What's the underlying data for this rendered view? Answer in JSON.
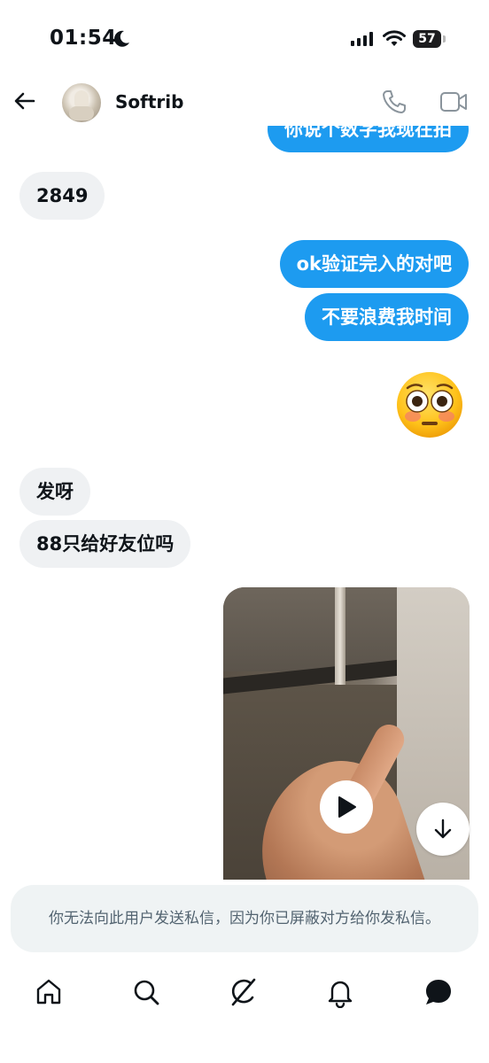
{
  "status_bar": {
    "time": "01:54",
    "battery": "57",
    "icons": [
      "moon-icon",
      "signal-icon",
      "wifi-icon",
      "battery-icon"
    ]
  },
  "header": {
    "username": "Softrib",
    "icons": [
      "back-arrow-icon",
      "phone-icon",
      "video-call-icon"
    ]
  },
  "messages": [
    {
      "side": "out",
      "text": "你说个数字我现在拍"
    },
    {
      "side": "in",
      "text": "2849"
    },
    {
      "side": "out",
      "text": "ok验证完入的对吧"
    },
    {
      "side": "out",
      "text": "不要浪费我时间"
    },
    {
      "side": "out",
      "emoji": "flushed-face"
    },
    {
      "side": "in",
      "text": "发呀"
    },
    {
      "side": "in",
      "text": "88只给好友位吗"
    },
    {
      "side": "out",
      "media": "video"
    }
  ],
  "notice": "你无法向此用户发送私信，因为你已屏蔽对方给你发私信。",
  "bottom_nav": {
    "items": [
      "home-icon",
      "search-icon",
      "grok-icon",
      "notifications-icon",
      "messages-icon"
    ],
    "active": "messages-icon"
  },
  "colors": {
    "accent": "#1d9bf0",
    "incoming_bubble": "#eff1f3",
    "notice_bg": "#eff3f4",
    "notice_text": "#536471"
  }
}
